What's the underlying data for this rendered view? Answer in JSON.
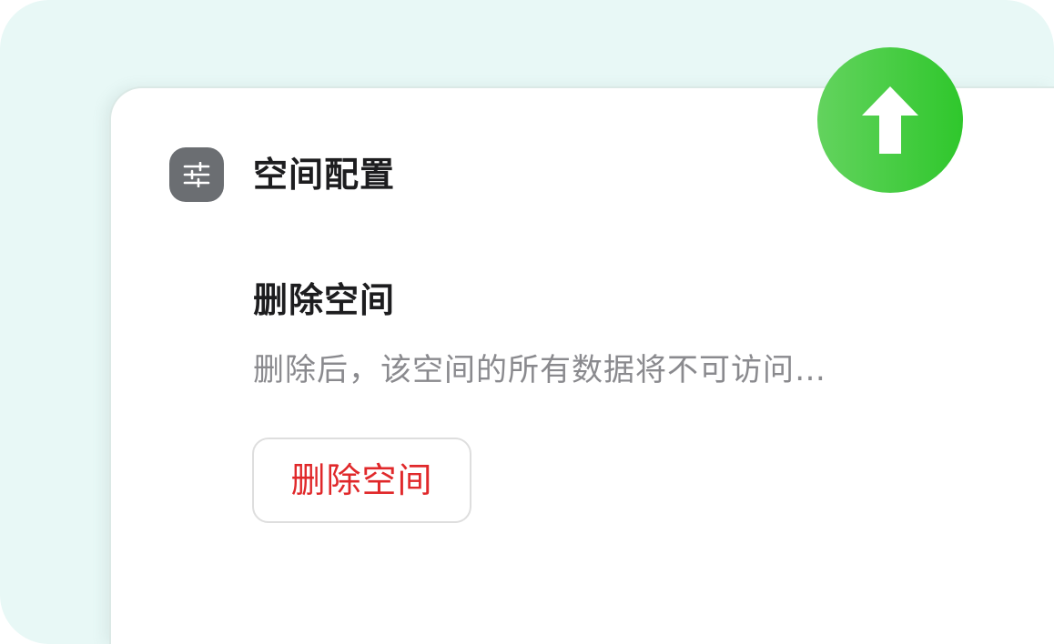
{
  "colors": {
    "backdrop": "#e8f8f6",
    "card": "#ffffff",
    "settings_icon_bg": "#6b6e72",
    "danger": "#e0282a",
    "upload_badge_start": "#63d35e",
    "upload_badge_end": "#2fc72c",
    "muted_text": "#8a8a8e",
    "primary_text": "#1d1d1f"
  },
  "header": {
    "icon": "sliders-icon",
    "title": "空间配置"
  },
  "delete_section": {
    "title": "删除空间",
    "description": "删除后，该空间的所有数据将不可访问…",
    "button_label": "删除空间"
  },
  "upload_badge": {
    "icon": "arrow-up-icon"
  }
}
